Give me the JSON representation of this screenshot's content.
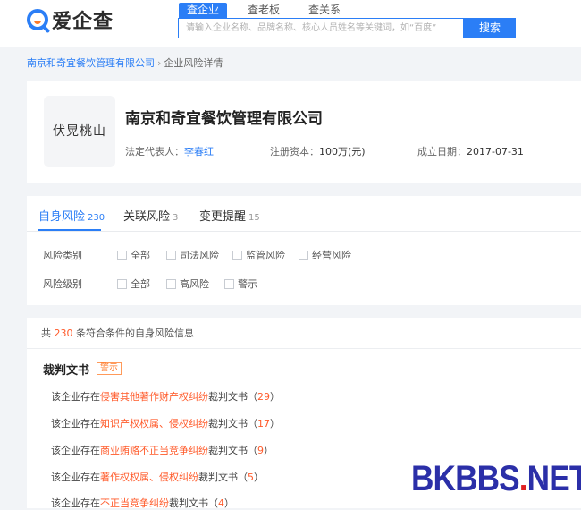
{
  "header": {
    "logo_text": "爱企查",
    "search_tabs": [
      "查企业",
      "查老板",
      "查关系"
    ],
    "search_placeholder": "请输入企业名称、品牌名称、核心人员姓名等关键词，如“百度”",
    "search_button": "搜索",
    "accent_color": "#2b7ef6"
  },
  "breadcrumb": {
    "company": "南京和奇宜餐饮管理有限公司",
    "separator": "›",
    "current": "企业风险详情"
  },
  "company": {
    "avatar_text": "伏晃桃山",
    "name": "南京和奇宜餐饮管理有限公司",
    "legal_rep_label": "法定代表人：",
    "legal_rep": "李春红",
    "capital_label": "注册资本：",
    "capital": "100万(元)",
    "founded_label": "成立日期：",
    "founded": "2017-07-31"
  },
  "tabs": [
    {
      "label": "自身风险",
      "count": "230"
    },
    {
      "label": "关联风险",
      "count": "3"
    },
    {
      "label": "变更提醒",
      "count": "15"
    }
  ],
  "filters": {
    "category_label": "风险类别",
    "category_options": [
      "全部",
      "司法风险",
      "监管风险",
      "经营风险"
    ],
    "level_label": "风险级别",
    "level_options": [
      "全部",
      "高风险",
      "警示"
    ]
  },
  "results": {
    "prefix": "共 ",
    "total": "230",
    "suffix": " 条符合条件的自身风险信息",
    "section_title": "裁判文书",
    "section_tag": "警示",
    "items": [
      {
        "pre": "该企业存在",
        "hl": "侵害其他著作财产权纠纷",
        "post": "裁判文书（",
        "count": "29",
        "end": "）"
      },
      {
        "pre": "该企业存在",
        "hl": "知识产权权属、侵权纠纷",
        "post": "裁判文书（",
        "count": "17",
        "end": "）"
      },
      {
        "pre": "该企业存在",
        "hl": "商业贿赂不正当竞争纠纷",
        "post": "裁判文书（",
        "count": "9",
        "end": "）"
      },
      {
        "pre": "该企业存在",
        "hl": "著作权权属、侵权纠纷",
        "post": "裁判文书（",
        "count": "5",
        "end": "）"
      },
      {
        "pre": "该企业存在",
        "hl": "不正当竞争纠纷",
        "post": "裁判文书（",
        "count": "4",
        "end": "）"
      }
    ]
  },
  "watermark": {
    "main": "BKBBS",
    "dot": ".",
    "tld": "NET"
  }
}
